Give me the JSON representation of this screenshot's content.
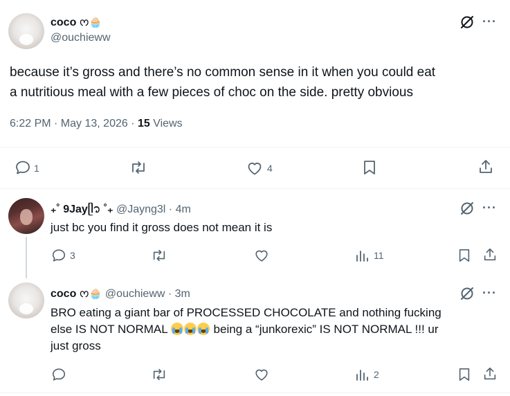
{
  "main_post": {
    "display_name": "coco",
    "name_emoji": "ᰔ🧁",
    "handle": "@ouchieww",
    "text_line1": "because it’s gross and there’s no common sense in it when you could eat",
    "text_line2": "a nutritious meal with a few pieces of choc on the side. pretty obvious",
    "time": "6:22 PM · May 13, 2026 · ",
    "views_count": "15",
    "views_label": " Views",
    "reply_count": "1",
    "like_count": "4"
  },
  "reply1": {
    "display_name": "₊˚ 9Jayᥫ᭡ ˚₊",
    "handle": "@Jayng3l",
    "time": " · 4m",
    "text": "just bc you find it gross does not mean it is",
    "reply_count": "3",
    "views_count": "11"
  },
  "reply2": {
    "display_name": "coco",
    "name_emoji": "ᰔ🧁",
    "handle": "@ouchieww",
    "time": " · 3m",
    "text_line1": "BRO eating a giant bar of PROCESSED CHOCOLATE and nothing fucking",
    "text_line2_a": "else IS NOT NORMAL ",
    "text_line2_b": " being a “junkorexic” IS NOT NORMAL !!! ur",
    "text_line3": "just gross",
    "views_count": "2"
  }
}
